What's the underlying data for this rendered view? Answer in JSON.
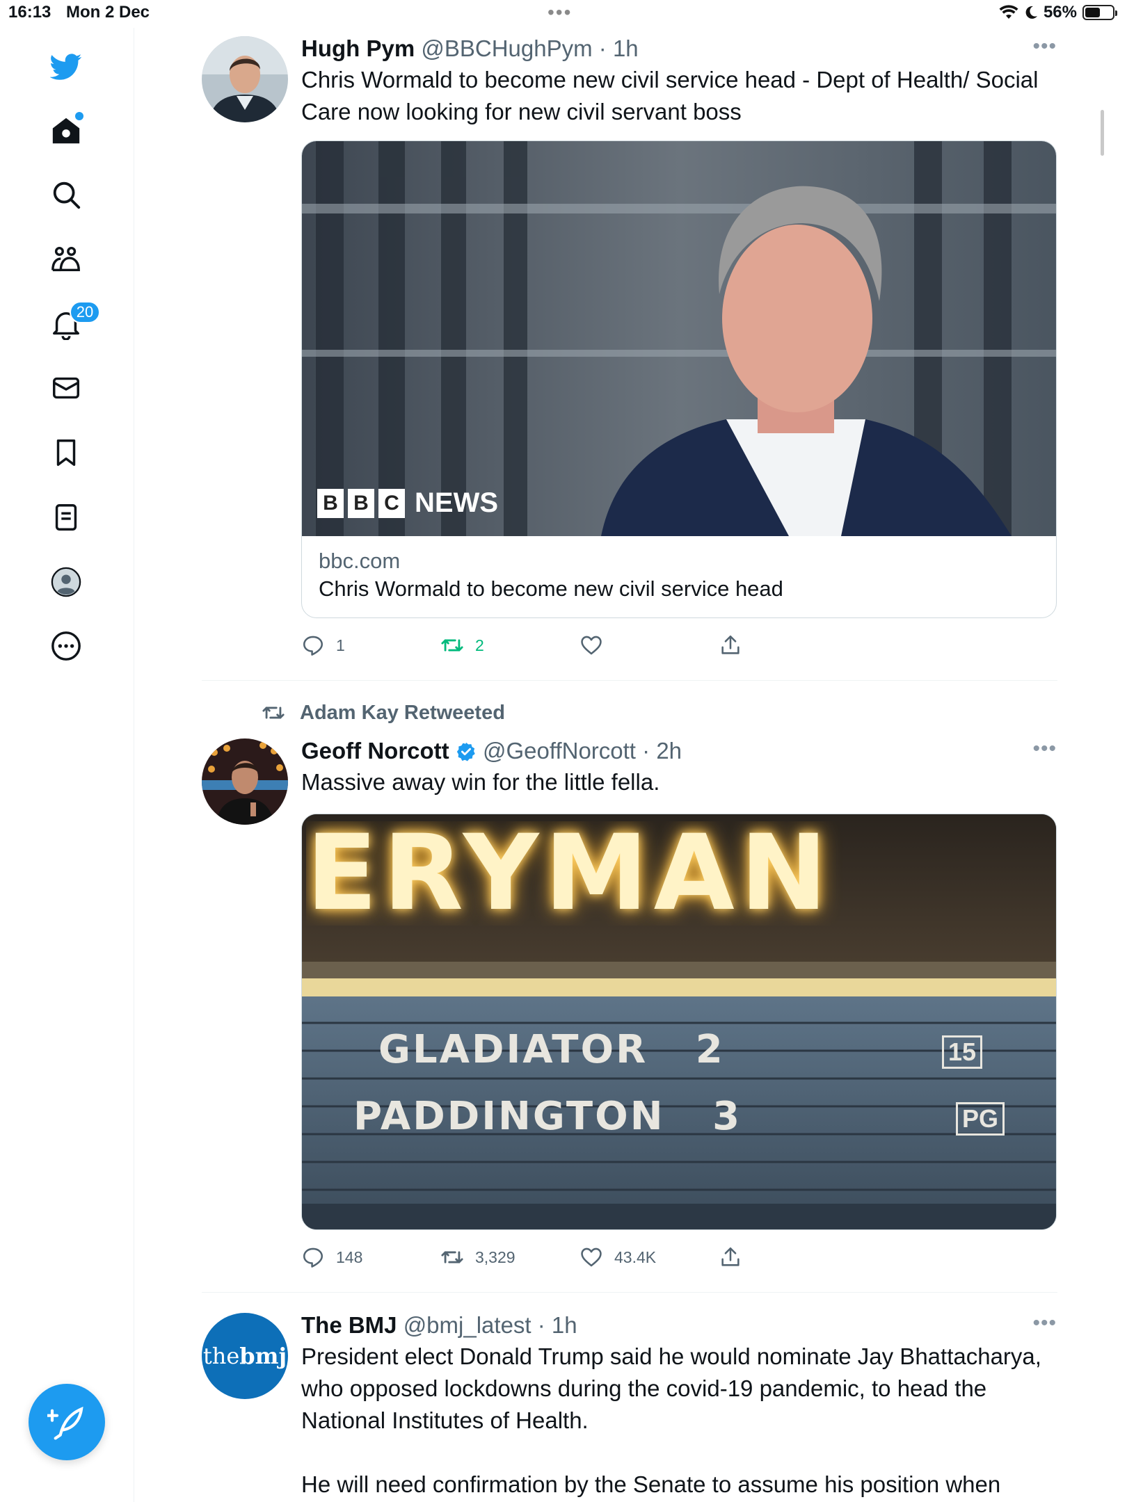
{
  "status_bar": {
    "time": "16:13",
    "date": "Mon 2 Dec",
    "battery": "56%",
    "battery_level": 0.56
  },
  "sidebar": {
    "notifications_badge": "20",
    "items": [
      "twitter-logo",
      "home",
      "search",
      "communities",
      "notifications",
      "messages",
      "bookmarks",
      "lists",
      "profile",
      "more"
    ]
  },
  "tweets": [
    {
      "name": "Hugh Pym",
      "handle": "@BBCHughPym",
      "time": "· 1h",
      "text": "Chris Wormald to become new civil service head - Dept of Health/ Social Care now looking for new civil servant boss",
      "card": {
        "brand_boxes": [
          "B",
          "B",
          "C"
        ],
        "brand_word": "NEWS",
        "domain": "bbc.com",
        "title": "Chris Wormald to become new civil service head"
      },
      "replies": "1",
      "retweets": "2"
    },
    {
      "retweeted_by": "Adam Kay Retweeted",
      "name": "Geoff Norcott",
      "handle": "@GeoffNorcott",
      "time": "· 2h",
      "text": "Massive away win for the little fella.",
      "sign": {
        "top": "ERYMAN",
        "line1": "GLADIATOR",
        "num1": "2",
        "rating1": "15",
        "line2": "PADDINGTON",
        "num2": "3",
        "rating2": "PG"
      },
      "replies": "148",
      "retweets": "3,329",
      "likes": "43.4K"
    },
    {
      "name": "The BMJ",
      "handle": "@bmj_latest",
      "time": "· 1h",
      "avatar_text_light": "the",
      "avatar_text_bold": "bmj",
      "text": "President elect Donald Trump said he would nominate Jay Bhattacharya, who opposed lockdowns during the covid-19 pandemic, to head the National Institutes of Health.",
      "text2": "He will need confirmation by the Senate to assume his position when"
    }
  ],
  "colors": {
    "accent": "#1d9bf0",
    "retweet": "#00ba7c",
    "secondary": "#536471"
  }
}
